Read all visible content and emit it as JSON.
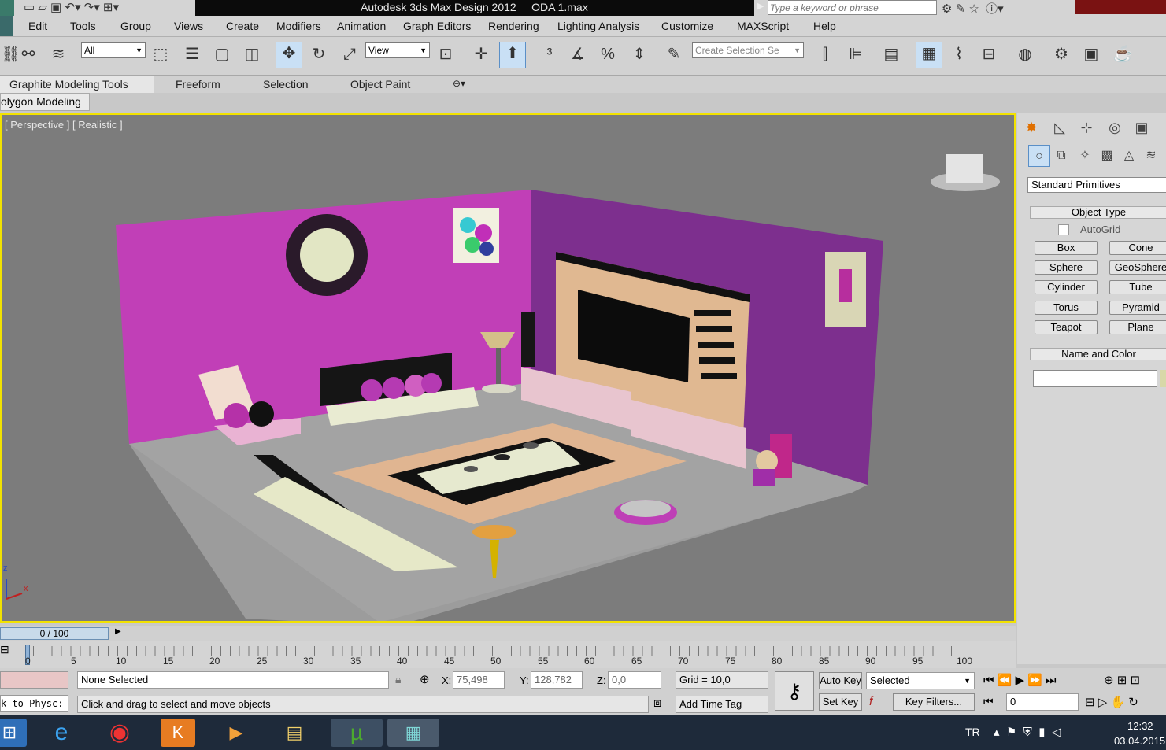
{
  "titlebar": {
    "title": "Autodesk 3ds Max Design 2012     ODA 1.max",
    "search_placeholder": "Type a keyword or phrase"
  },
  "menubar": {
    "items": [
      "Edit",
      "Tools",
      "Group",
      "Views",
      "Create",
      "Modifiers",
      "Animation",
      "Graph Editors",
      "Rendering",
      "Lighting Analysis",
      "Customize",
      "MAXScript",
      "Help"
    ]
  },
  "toolbar": {
    "filter_value": "All",
    "coord_value": "View",
    "selection_set_placeholder": "Create Selection Se"
  },
  "ribbon": {
    "tabs": [
      "Graphite Modeling Tools",
      "Freeform",
      "Selection",
      "Object Paint"
    ],
    "subtab": "olygon Modeling"
  },
  "viewport": {
    "label": "[ Perspective ] [ Realistic ]",
    "axis_z": "z",
    "axis_x": "x"
  },
  "cmdpanel": {
    "category": "Standard Primitives",
    "object_type_header": "Object Type",
    "autogrid_label": "AutoGrid",
    "buttons": [
      "Box",
      "Cone",
      "Sphere",
      "GeoSphere",
      "Cylinder",
      "Tube",
      "Torus",
      "Pyramid",
      "Teapot",
      "Plane"
    ],
    "name_color_header": "Name and Color"
  },
  "timeline": {
    "frame_display": "0 / 100",
    "ticks": [
      "0",
      "5",
      "10",
      "15",
      "20",
      "25",
      "30",
      "35",
      "40",
      "45",
      "50",
      "55",
      "60",
      "65",
      "70",
      "75",
      "80",
      "85",
      "90",
      "95",
      "100"
    ]
  },
  "status": {
    "physc_label": "k to Physc:",
    "selection_status": "None Selected",
    "prompt": "Click and drag to select and move objects",
    "x_label": "X:",
    "x_value": "75,498",
    "y_label": "Y:",
    "y_value": "128,782",
    "z_label": "Z:",
    "z_value": "0,0",
    "grid": "Grid = 10,0",
    "add_time_tag": "Add Time Tag",
    "auto_key": "Auto Key",
    "set_key": "Set Key",
    "selected_dropdown": "Selected",
    "key_filters": "Key Filters...",
    "frame_field": "0"
  },
  "taskbar": {
    "lang": "TR",
    "time": "12:32",
    "date": "03.04.2015"
  }
}
